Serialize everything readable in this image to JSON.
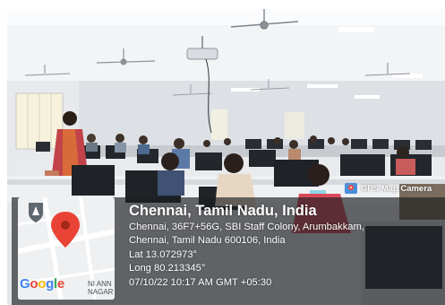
{
  "photo": {
    "subject-icon": "computer-lab-photo"
  },
  "overlay": {
    "brand_label": "GPS Map Camera",
    "location_title": "Chennai, Tamil Nadu, India",
    "address_line1": "Chennai, 36F7+56G, SBI Staff Colony, Arumbakkam,",
    "address_line2": "Chennai, Tamil Nadu 600106, India",
    "latitude": "Lat 13.072973°",
    "longitude": "Long 80.213345°",
    "timestamp": "07/10/22 10:17 AM GMT +05:30"
  },
  "map": {
    "street_label": "NI ANN NAGAR",
    "logo": {
      "g1": "G",
      "o1": "o",
      "o2": "o",
      "g2": "g",
      "l": "l",
      "e": "e"
    },
    "logo_colors": {
      "blue": "#4285f4",
      "red": "#ea4335",
      "yellow": "#fbbc05",
      "green": "#34a853"
    }
  },
  "colors": {
    "pin": "#e94335",
    "ceiling": "#f4f5f7",
    "wall": "#dfe3e6",
    "desk": "#ebecef",
    "monitor": "#23272c"
  }
}
